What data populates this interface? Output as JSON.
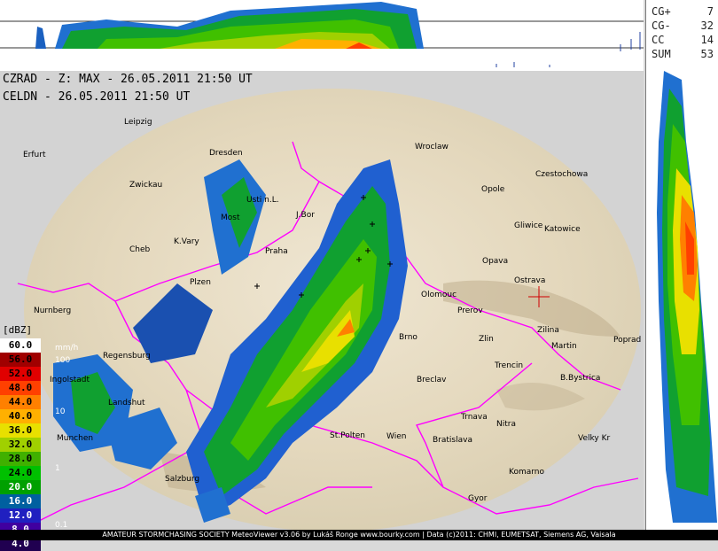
{
  "header": {
    "line1": "CZRAD - Z: MAX - 26.05.2011 21:50 UT",
    "line2": "CELDN - 26.05.2011 21:50 UT"
  },
  "lightning_stats": [
    {
      "key": "CG+",
      "value": "7"
    },
    {
      "key": "CG-",
      "value": "32"
    },
    {
      "key": "CC",
      "value": "14"
    },
    {
      "key": "SUM",
      "value": "53"
    }
  ],
  "legend": {
    "unit": "[dBZ]",
    "levels": [
      {
        "label": "60.0",
        "color": "#ffffff",
        "text": "#000000"
      },
      {
        "label": "56.0",
        "color": "#a00000",
        "text": "#000000"
      },
      {
        "label": "52.0",
        "color": "#e00000",
        "text": "#000000"
      },
      {
        "label": "48.0",
        "color": "#ff4000",
        "text": "#000000"
      },
      {
        "label": "44.0",
        "color": "#ff8000",
        "text": "#000000"
      },
      {
        "label": "40.0",
        "color": "#ffb000",
        "text": "#000000"
      },
      {
        "label": "36.0",
        "color": "#e8e000",
        "text": "#000000"
      },
      {
        "label": "32.0",
        "color": "#a0d000",
        "text": "#000000"
      },
      {
        "label": "28.0",
        "color": "#40b000",
        "text": "#000000"
      },
      {
        "label": "24.0",
        "color": "#00c000",
        "text": "#000000"
      },
      {
        "label": "20.0",
        "color": "#00a000",
        "text": "#ffffff"
      },
      {
        "label": "16.0",
        "color": "#0060a0",
        "text": "#ffffff"
      },
      {
        "label": "12.0",
        "color": "#2020c0",
        "text": "#ffffff"
      },
      {
        "label": "8.0",
        "color": "#4000a0",
        "text": "#ffffff"
      },
      {
        "label": "4.0",
        "color": "#200050",
        "text": "#ffffff"
      }
    ],
    "rain_scale": [
      "mm/h",
      "100",
      "10",
      "1",
      "0.1"
    ]
  },
  "cities": [
    {
      "name": "Leipzig"
    },
    {
      "name": "Erfurt"
    },
    {
      "name": "Dresden"
    },
    {
      "name": "Zwickau"
    },
    {
      "name": "Wroclaw"
    },
    {
      "name": "Czestochowa"
    },
    {
      "name": "Opole"
    },
    {
      "name": "Gliwice"
    },
    {
      "name": "Katowice"
    },
    {
      "name": "Usti n.L."
    },
    {
      "name": "Most"
    },
    {
      "name": "K.Vary"
    },
    {
      "name": "Cheb"
    },
    {
      "name": "Praha"
    },
    {
      "name": "Plzen"
    },
    {
      "name": "Olomouc"
    },
    {
      "name": "Opava"
    },
    {
      "name": "Ostrava"
    },
    {
      "name": "Prerov"
    },
    {
      "name": "Zlin"
    },
    {
      "name": "Brno"
    },
    {
      "name": "Zilina"
    },
    {
      "name": "Martin"
    },
    {
      "name": "Poprad"
    },
    {
      "name": "Nurnberg"
    },
    {
      "name": "Trencin"
    },
    {
      "name": "B.Bystrica"
    },
    {
      "name": "Breclav"
    },
    {
      "name": "Trnava"
    },
    {
      "name": "Nitra"
    },
    {
      "name": "St.Polten"
    },
    {
      "name": "Wien"
    },
    {
      "name": "Bratislava"
    },
    {
      "name": "Velky Kr"
    },
    {
      "name": "Landshut"
    },
    {
      "name": "Salzburg"
    },
    {
      "name": "Komarno"
    },
    {
      "name": "Gyor"
    },
    {
      "name": "Regensburg"
    },
    {
      "name": "Ingolstadt"
    },
    {
      "name": "J.Bor"
    },
    {
      "name": "Munchen"
    }
  ],
  "footer": "AMATEUR STORMCHASING SOCIETY MeteoViewer v3.06 by Lukáš Ronge www.bourky.com | Data (c)2011: CHMI, EUMETSAT, Siemens AG, Vaisala"
}
